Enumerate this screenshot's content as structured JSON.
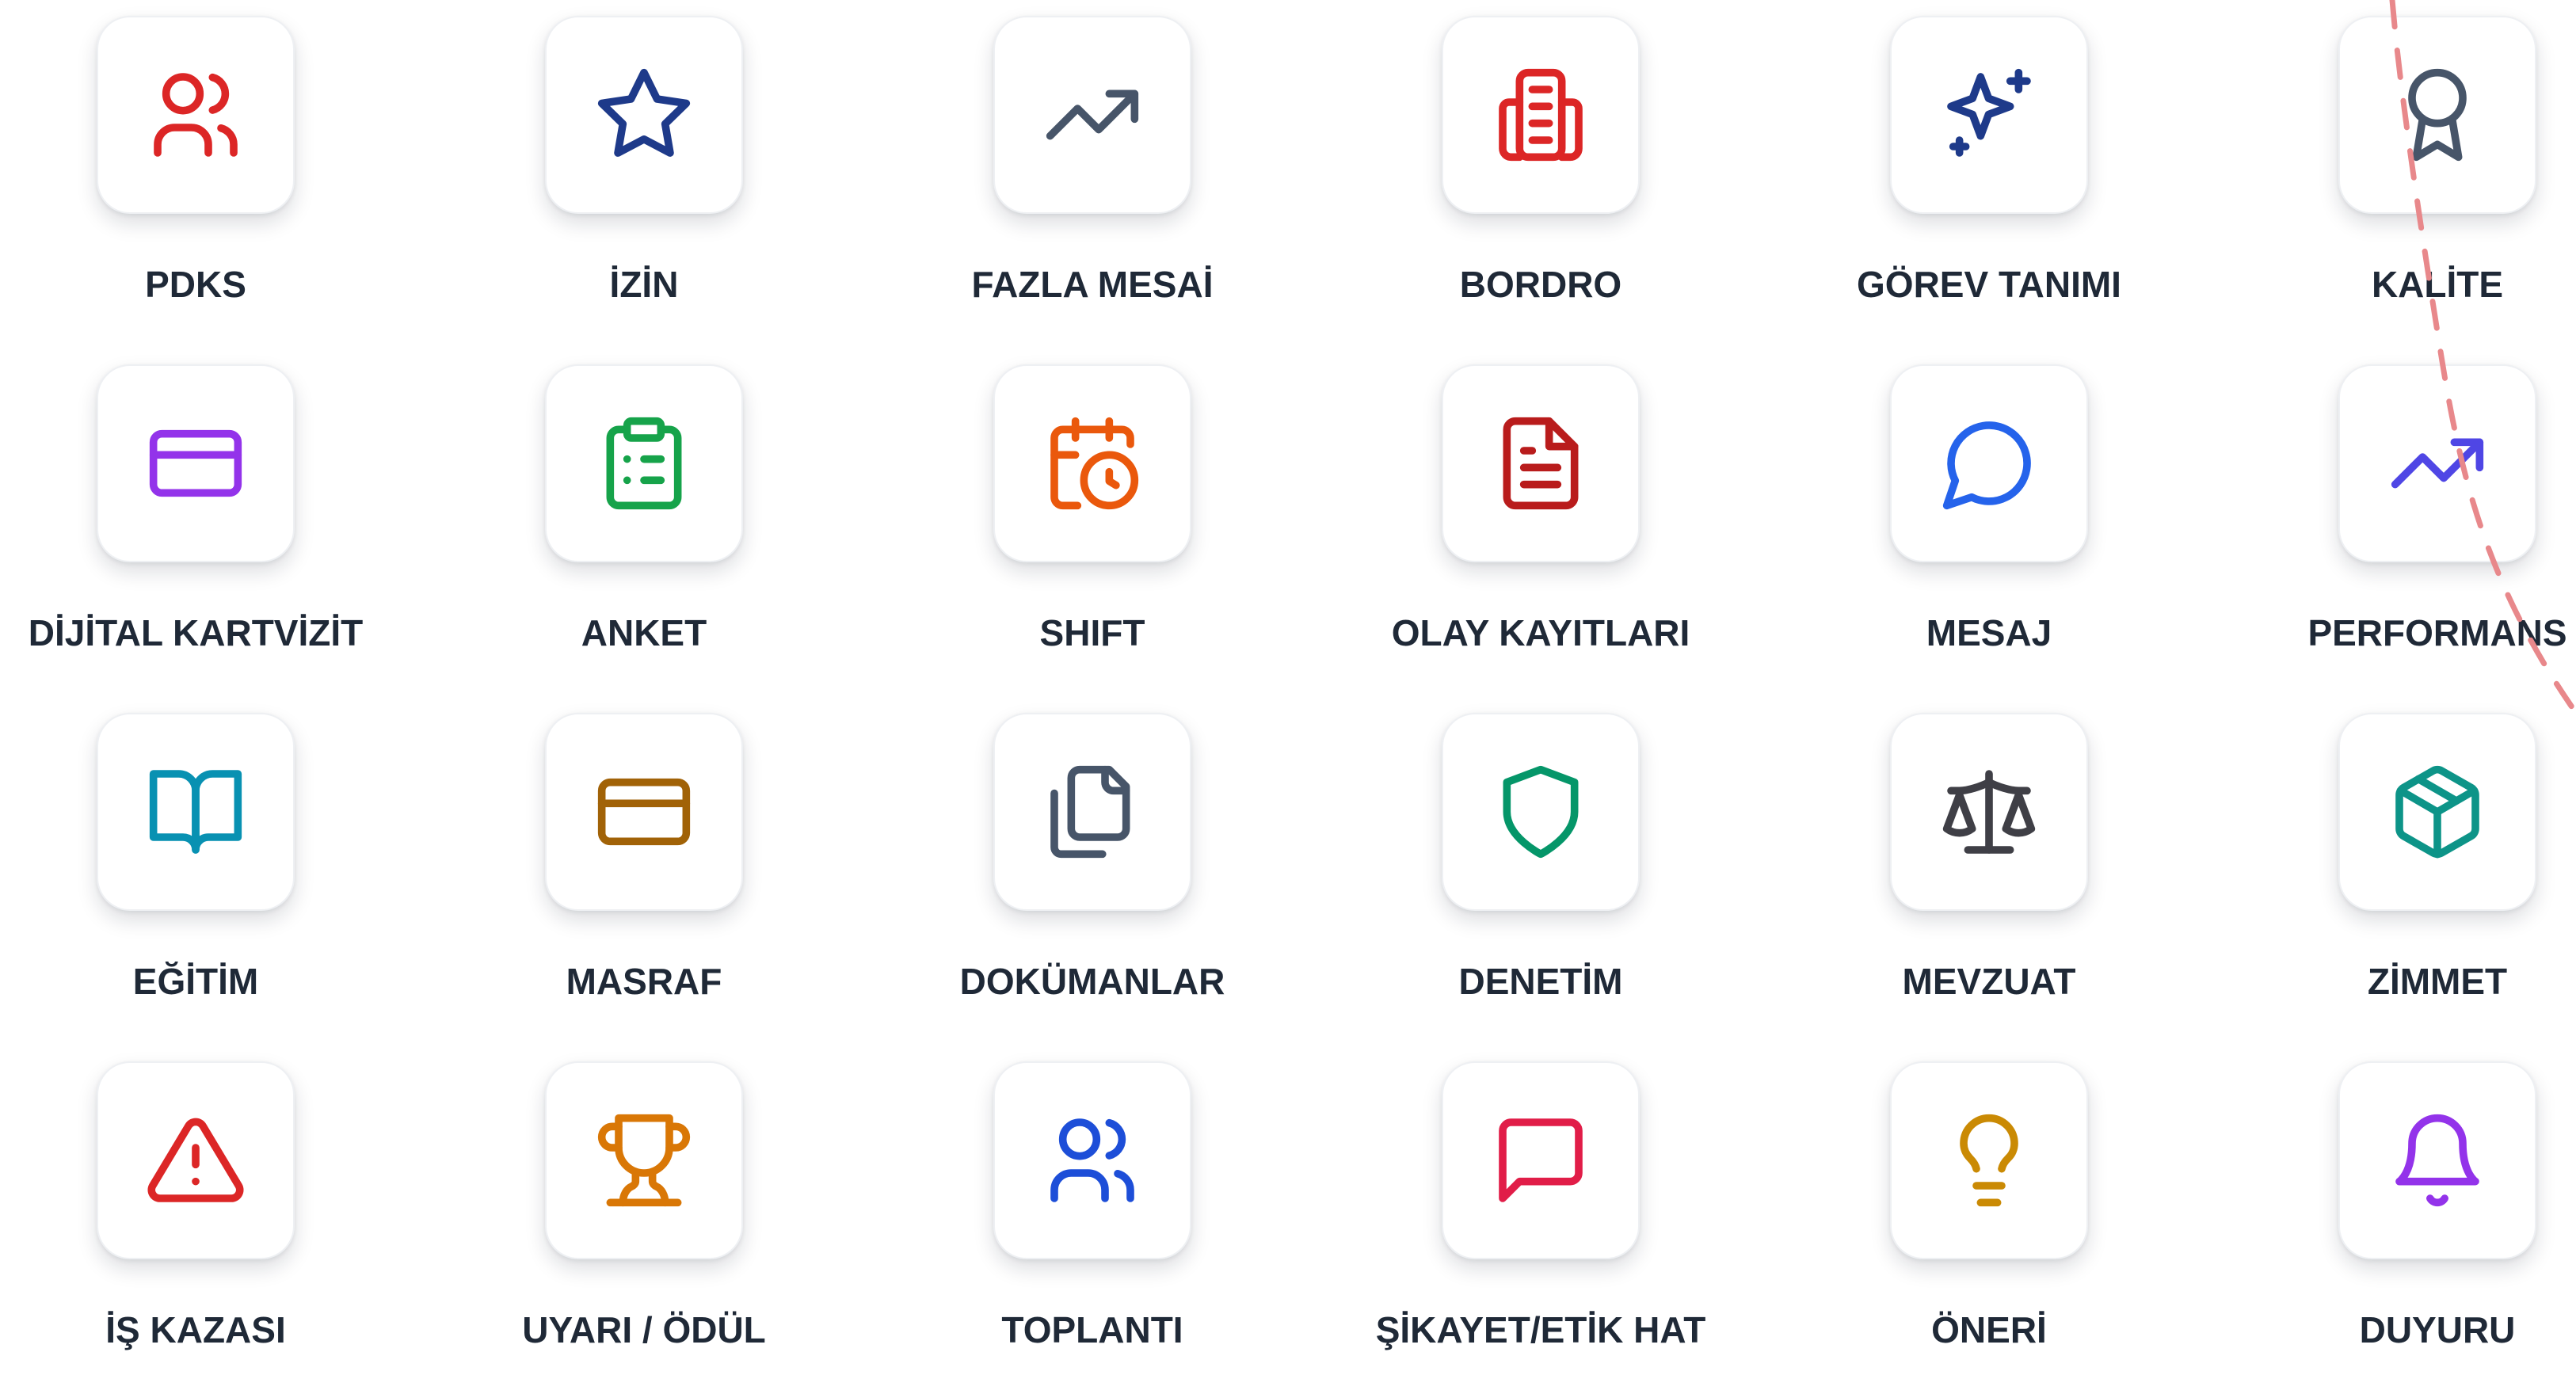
{
  "colors": {
    "label": "#1f2937",
    "card_background": "#ffffff",
    "card_border": "#eef0f3",
    "dashed_path": "#e8888b"
  },
  "modules": [
    {
      "label": "PDKS",
      "icon": "users-icon",
      "color": "#dc2626"
    },
    {
      "label": "İZİN",
      "icon": "star-icon",
      "color": "#1e3a8a"
    },
    {
      "label": "FAZLA MESAİ",
      "icon": "trending-up-icon",
      "color": "#475569"
    },
    {
      "label": "BORDRO",
      "icon": "building-icon",
      "color": "#dc2626"
    },
    {
      "label": "GÖREV TANIMI",
      "icon": "sparkles-icon",
      "color": "#1e3a8a"
    },
    {
      "label": "KALİTE",
      "icon": "award-icon",
      "color": "#475569"
    },
    {
      "label": "DİJİTAL KARTVİZİT",
      "icon": "credit-card-icon",
      "color": "#9333ea"
    },
    {
      "label": "ANKET",
      "icon": "clipboard-list-icon",
      "color": "#16a34a"
    },
    {
      "label": "SHIFT",
      "icon": "calendar-clock-icon",
      "color": "#ea580c"
    },
    {
      "label": "OLAY KAYITLARI",
      "icon": "file-text-icon",
      "color": "#b91c1c"
    },
    {
      "label": "MESAJ",
      "icon": "message-circle-icon",
      "color": "#2563eb"
    },
    {
      "label": "PERFORMANS",
      "icon": "trending-up-icon",
      "color": "#4f46e5"
    },
    {
      "label": "EĞİTİM",
      "icon": "book-open-icon",
      "color": "#0891b2"
    },
    {
      "label": "MASRAF",
      "icon": "wallet-card-icon",
      "color": "#a16207"
    },
    {
      "label": "DOKÜMANLAR",
      "icon": "files-icon",
      "color": "#475569"
    },
    {
      "label": "DENETİM",
      "icon": "shield-icon",
      "color": "#059669"
    },
    {
      "label": "MEVZUAT",
      "icon": "scale-icon",
      "color": "#3f3f46"
    },
    {
      "label": "ZİMMET",
      "icon": "package-icon",
      "color": "#0d9488"
    },
    {
      "label": "İŞ KAZASI",
      "icon": "alert-triangle-icon",
      "color": "#dc2626"
    },
    {
      "label": "UYARI / ÖDÜL",
      "icon": "trophy-icon",
      "color": "#d97706"
    },
    {
      "label": "TOPLANTI",
      "icon": "users-icon",
      "color": "#1d4ed8"
    },
    {
      "label": "ŞİKAYET/ETİK HAT",
      "icon": "message-square-icon",
      "color": "#e11d48"
    },
    {
      "label": "ÖNERİ",
      "icon": "lightbulb-icon",
      "color": "#ca8a04"
    },
    {
      "label": "DUYURU",
      "icon": "bell-icon",
      "color": "#9333ea"
    }
  ]
}
